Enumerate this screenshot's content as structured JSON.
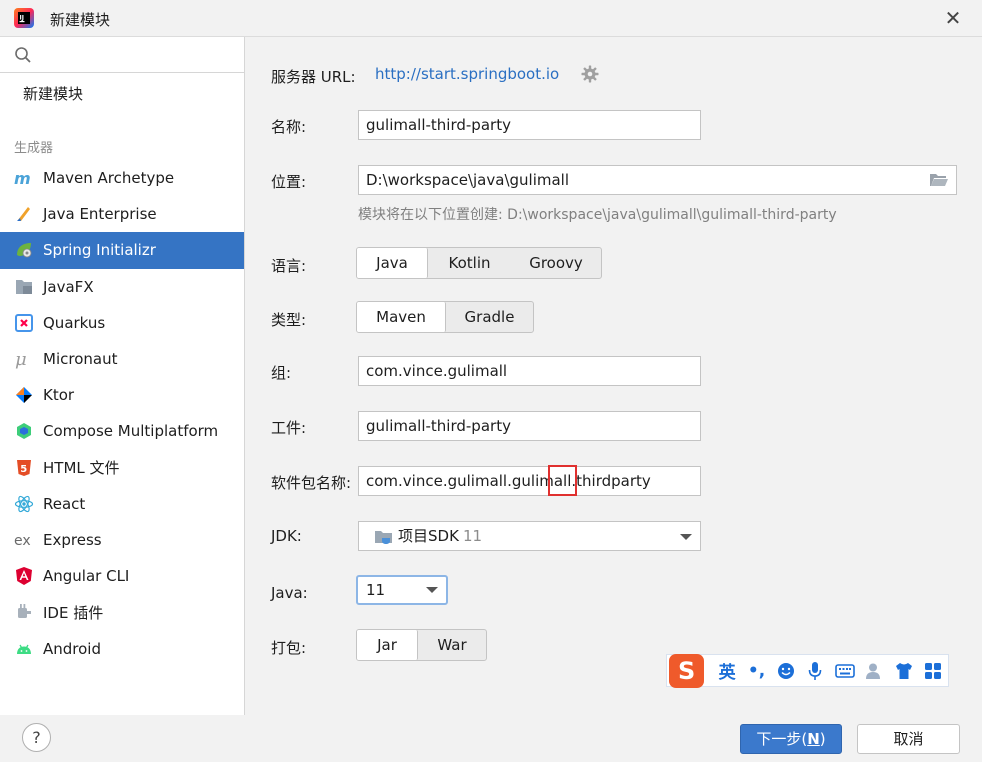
{
  "window": {
    "title": "新建模块"
  },
  "sidebar": {
    "new_module_label": "新建模块",
    "section_label": "生成器",
    "items": [
      {
        "label": "Maven Archetype",
        "icon": "maven-icon"
      },
      {
        "label": "Java Enterprise",
        "icon": "java-enterprise-icon"
      },
      {
        "label": "Spring Initializr",
        "icon": "spring-icon",
        "selected": true
      },
      {
        "label": "JavaFX",
        "icon": "javafx-icon"
      },
      {
        "label": "Quarkus",
        "icon": "quarkus-icon"
      },
      {
        "label": "Micronaut",
        "icon": "micronaut-icon"
      },
      {
        "label": "Ktor",
        "icon": "ktor-icon"
      },
      {
        "label": "Compose Multiplatform",
        "icon": "compose-icon"
      },
      {
        "label": "HTML 文件",
        "icon": "html5-icon"
      },
      {
        "label": "React",
        "icon": "react-icon"
      },
      {
        "label": "Express",
        "icon": "express-icon"
      },
      {
        "label": "Angular CLI",
        "icon": "angular-icon"
      },
      {
        "label": "IDE 插件",
        "icon": "ide-plugin-icon"
      },
      {
        "label": "Android",
        "icon": "android-icon"
      }
    ]
  },
  "form": {
    "server_url_label": "服务器 URL:",
    "server_url": "http://start.springboot.io",
    "name_label": "名称:",
    "name_value": "gulimall-third-party",
    "location_label": "位置:",
    "location_value": "D:\\workspace\\java\\gulimall",
    "location_hint": "模块将在以下位置创建: D:\\workspace\\java\\gulimall\\gulimall-third-party",
    "language_label": "语言:",
    "languages": [
      "Java",
      "Kotlin",
      "Groovy"
    ],
    "type_label": "类型:",
    "types": [
      "Maven",
      "Gradle"
    ],
    "group_label": "组:",
    "group_value": "com.vince.gulimall",
    "artifact_label": "工件:",
    "artifact_value": "gulimall-third-party",
    "package_label": "软件包名称:",
    "package_value": "com.vince.gulimall.gulimall.thirdparty",
    "jdk_label": "JDK:",
    "jdk_name": "项目SDK",
    "jdk_version": "11",
    "java_label": "Java:",
    "java_value": "11",
    "packaging_label": "打包:",
    "packagings": [
      "Jar",
      "War"
    ]
  },
  "ime": {
    "logo": "S",
    "lang": "英",
    "punct": "•,"
  },
  "footer": {
    "help_label": "?",
    "next_label": "下一步(",
    "next_mnemonic": "N",
    "next_suffix": ")",
    "cancel_label": "取消"
  },
  "colors": {
    "accent": "#3574c4",
    "link": "#2a6fc2",
    "highlight": "#e0302f",
    "ime_brand": "#ef5a2b"
  }
}
